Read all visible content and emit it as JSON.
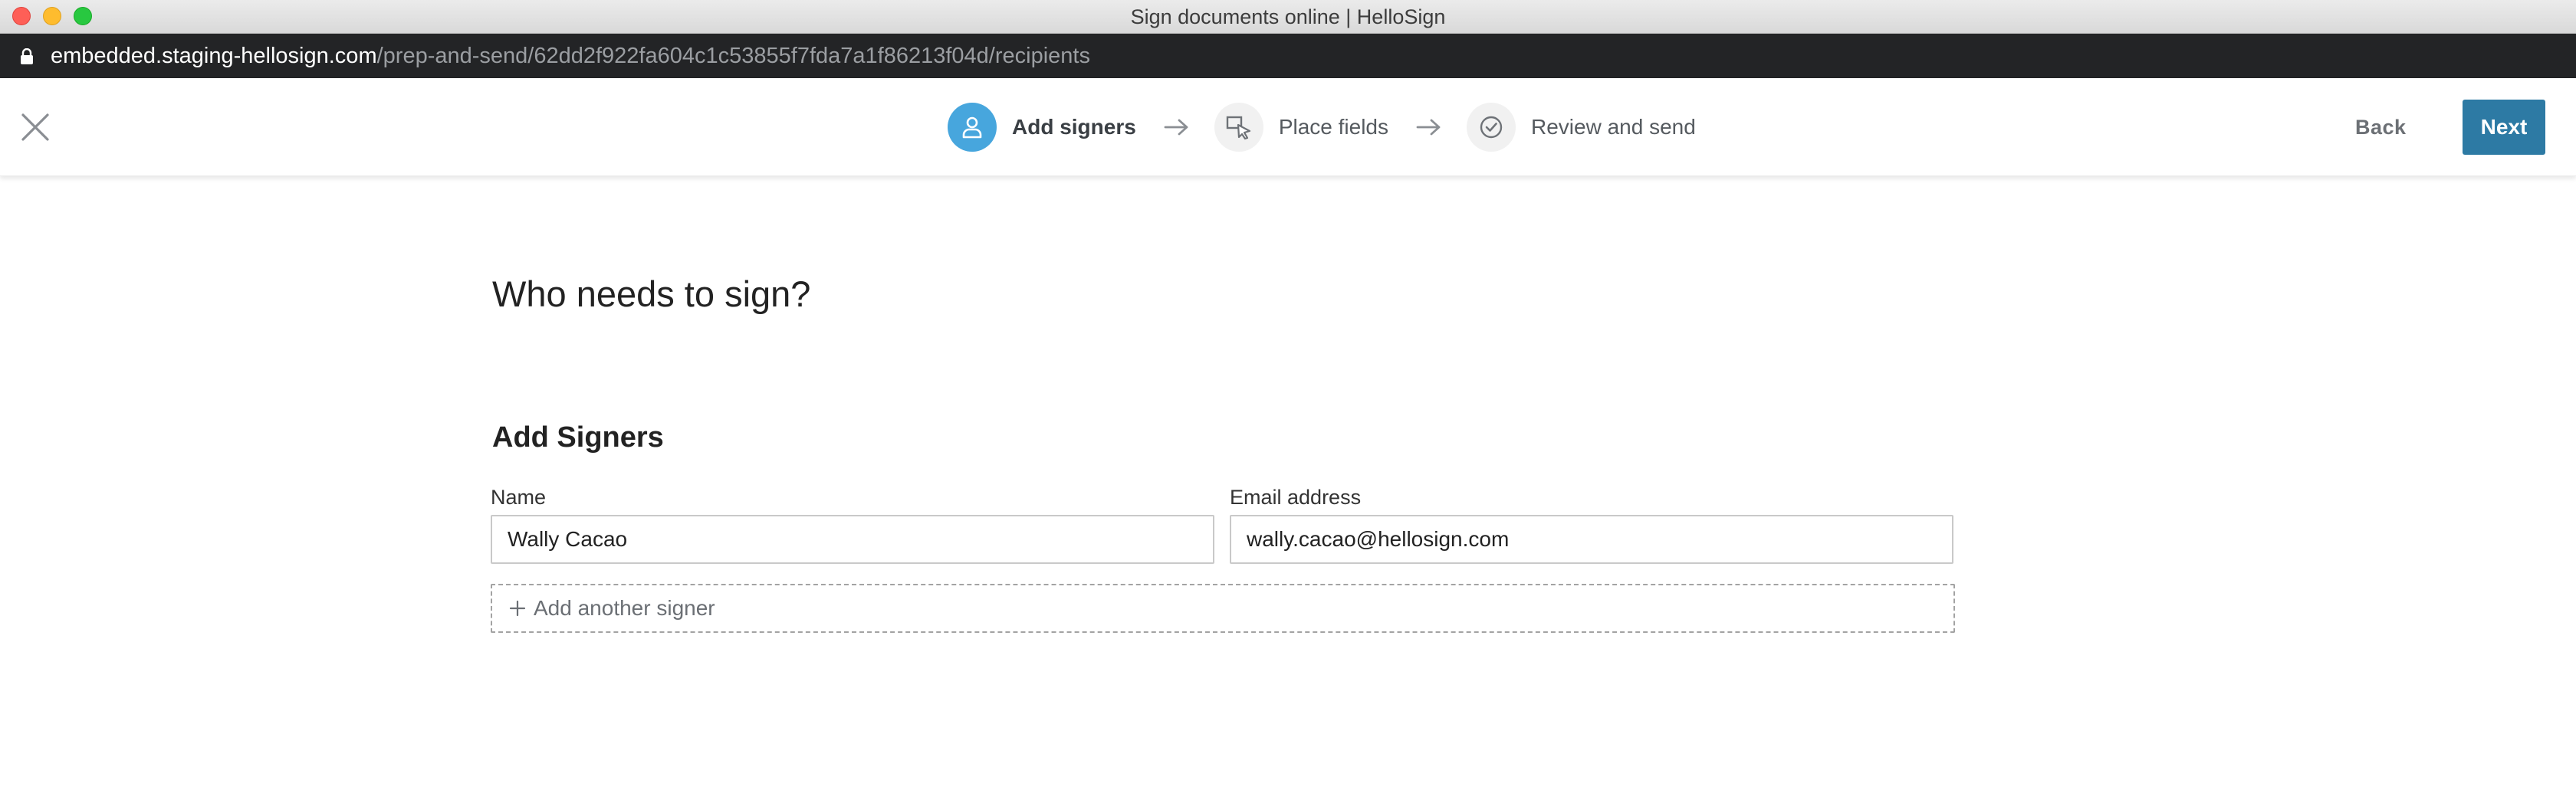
{
  "window": {
    "title": "Sign documents online | HelloSign"
  },
  "browser": {
    "url_host": "embedded.staging-hellosign.com",
    "url_path": "/prep-and-send/62dd2f922fa604c1c53855f7fda7a1f86213f04d/recipients"
  },
  "header": {
    "steps": [
      {
        "label": "Add signers",
        "icon": "person-icon",
        "active": true
      },
      {
        "label": "Place fields",
        "icon": "cursor-field-icon",
        "active": false
      },
      {
        "label": "Review and send",
        "icon": "check-circle-icon",
        "active": false
      }
    ],
    "back_label": "Back",
    "next_label": "Next"
  },
  "main": {
    "page_title": "Who needs to sign?",
    "section_title": "Add Signers",
    "signers": [
      {
        "name_label": "Name",
        "name_value": "Wally Cacao",
        "email_label": "Email address",
        "email_value": "wally.cacao@hellosign.com"
      }
    ],
    "add_signer_label": "Add another signer"
  },
  "colors": {
    "accent": "#47a6dd",
    "primary_button": "#2d7aa4",
    "url_bar": "#232426"
  }
}
